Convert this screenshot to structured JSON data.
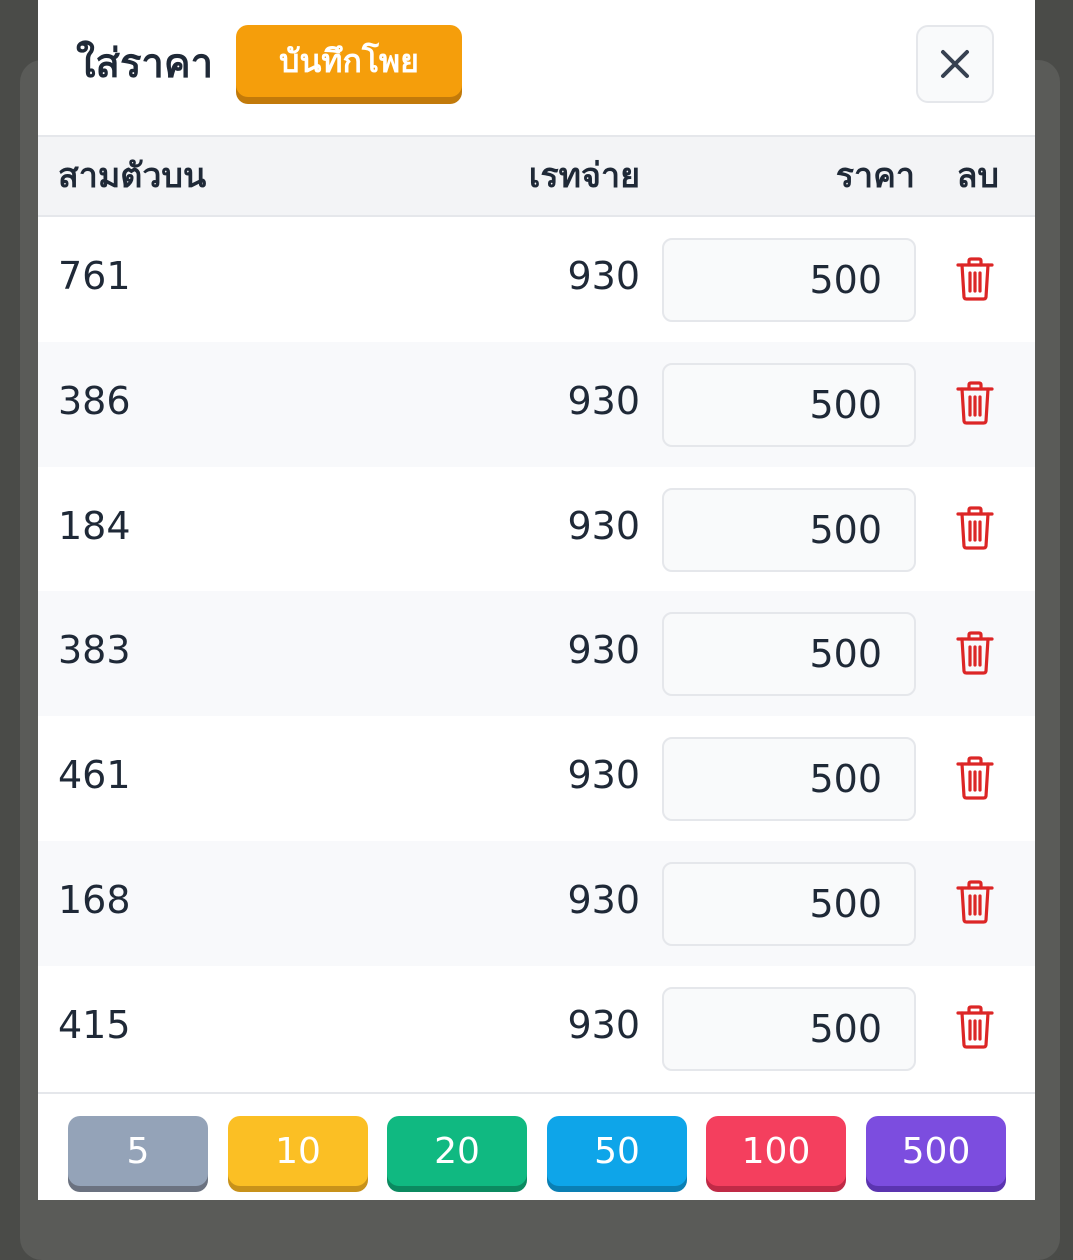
{
  "modal": {
    "title": "ใส่ราคา",
    "save_label": "บันทึกโพย",
    "close_icon": "close-icon"
  },
  "table": {
    "headers": {
      "number": "สามตัวบน",
      "rate": "เรทจ่าย",
      "price": "ราคา",
      "delete": "ลบ"
    },
    "rows": [
      {
        "number": "761",
        "rate": "930",
        "price": "500"
      },
      {
        "number": "386",
        "rate": "930",
        "price": "500"
      },
      {
        "number": "184",
        "rate": "930",
        "price": "500"
      },
      {
        "number": "383",
        "rate": "930",
        "price": "500"
      },
      {
        "number": "461",
        "rate": "930",
        "price": "500"
      },
      {
        "number": "168",
        "rate": "930",
        "price": "500"
      },
      {
        "number": "415",
        "rate": "930",
        "price": "500"
      }
    ],
    "delete_icon": "trash-icon"
  },
  "quick_amounts": [
    {
      "label": "5",
      "color": "#94a3b8",
      "shadow": "#6b7280"
    },
    {
      "label": "10",
      "color": "#fbbf24",
      "shadow": "#c8921a"
    },
    {
      "label": "20",
      "color": "#10b981",
      "shadow": "#0b8a60"
    },
    {
      "label": "50",
      "color": "#0ea5e9",
      "shadow": "#0a7fb4"
    },
    {
      "label": "100",
      "color": "#f43f5e",
      "shadow": "#c02a46"
    },
    {
      "label": "500",
      "color": "#7c4ddf",
      "shadow": "#5b34b0"
    }
  ],
  "colors": {
    "accent": "#f59e0b",
    "danger": "#dc2626",
    "text": "#1f2937"
  }
}
